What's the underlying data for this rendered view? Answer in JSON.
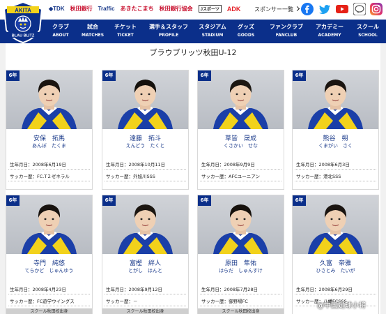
{
  "header": {
    "logo_text_top": "AKITA",
    "logo_text_bottom": "BLAU BLITZ",
    "sponsors": [
      "◆TDK",
      "秋田銀行",
      "Traffic",
      "あきたこまち",
      "秋田銀行協会",
      "Jスポーツ",
      "ADK"
    ],
    "sponsor_link": "スポンサー一覧",
    "social": [
      "facebook-icon",
      "twitter-icon",
      "youtube-icon",
      "line-icon",
      "instagram-icon"
    ]
  },
  "nav": [
    {
      "jp": "クラブ",
      "en": "ABOUT"
    },
    {
      "jp": "試合",
      "en": "MATCHES"
    },
    {
      "jp": "チケット",
      "en": "TICKET"
    },
    {
      "jp": "選手＆スタッフ",
      "en": "PROFILE"
    },
    {
      "jp": "スタジアム",
      "en": "STADIUM"
    },
    {
      "jp": "グッズ",
      "en": "GOODS"
    },
    {
      "jp": "ファンクラブ",
      "en": "FANCLUB"
    },
    {
      "jp": "アカデミー",
      "en": "ACADEMY"
    },
    {
      "jp": "スクール",
      "en": "SCHOOL"
    }
  ],
  "page_title": "ブラウブリッツ秋田U-12",
  "players": [
    {
      "grade": "6年",
      "name": "安保　拓馬",
      "kana": "あんぼ　たくま",
      "birth": "生年月日：2008年6月19日",
      "history": "サッカー歴：FC.T２ゼネラル",
      "school": ""
    },
    {
      "grade": "6年",
      "name": "遠藤　拓斗",
      "kana": "えんどう　たくと",
      "birth": "生年月日：2008年10月11日",
      "history": "サッカー歴：外旭川SSS",
      "school": ""
    },
    {
      "grade": "6年",
      "name": "草皆　晟成",
      "kana": "くさかい　せな",
      "birth": "生年月日：2008年9月9日",
      "history": "サッカー歴：AFCユーニアン",
      "school": ""
    },
    {
      "grade": "6年",
      "name": "熊谷　朔",
      "kana": "くまがい　さく",
      "birth": "生年月日：2008年6月3日",
      "history": "サッカー歴：港北SSS",
      "school": ""
    },
    {
      "grade": "6年",
      "name": "寺門　純悠",
      "kana": "てらかど　じゅんゆう",
      "birth": "生年月日：2008年4月23日",
      "history": "サッカー歴：FC遊学ウイングス",
      "school": "スクール秋田校出身"
    },
    {
      "grade": "6年",
      "name": "富樫　絆人",
      "kana": "とがし　はんと",
      "birth": "生年月日：2008年9月12日",
      "history": "サッカー歴：－",
      "school": "スクール秋田校出身"
    },
    {
      "grade": "6年",
      "name": "原田　隼佑",
      "kana": "はらだ　しゅんすけ",
      "birth": "生年月日：2008年7月28日",
      "history": "サッカー歴：御野場FC",
      "school": "スクール秋田校出身"
    },
    {
      "grade": "6年",
      "name": "久富　帝雅",
      "kana": "ひさとみ　たいが",
      "birth": "生年月日：2008年6月29日",
      "history": "サッカー歴：八幡FCSSS",
      "school": ""
    }
  ],
  "watermark": "@中国足球小将",
  "colors": {
    "navy": "#0b2f8a",
    "jersey_blue": "#1b3fa8",
    "jersey_yellow": "#f2d21b",
    "accent_red": "#c8102e"
  }
}
